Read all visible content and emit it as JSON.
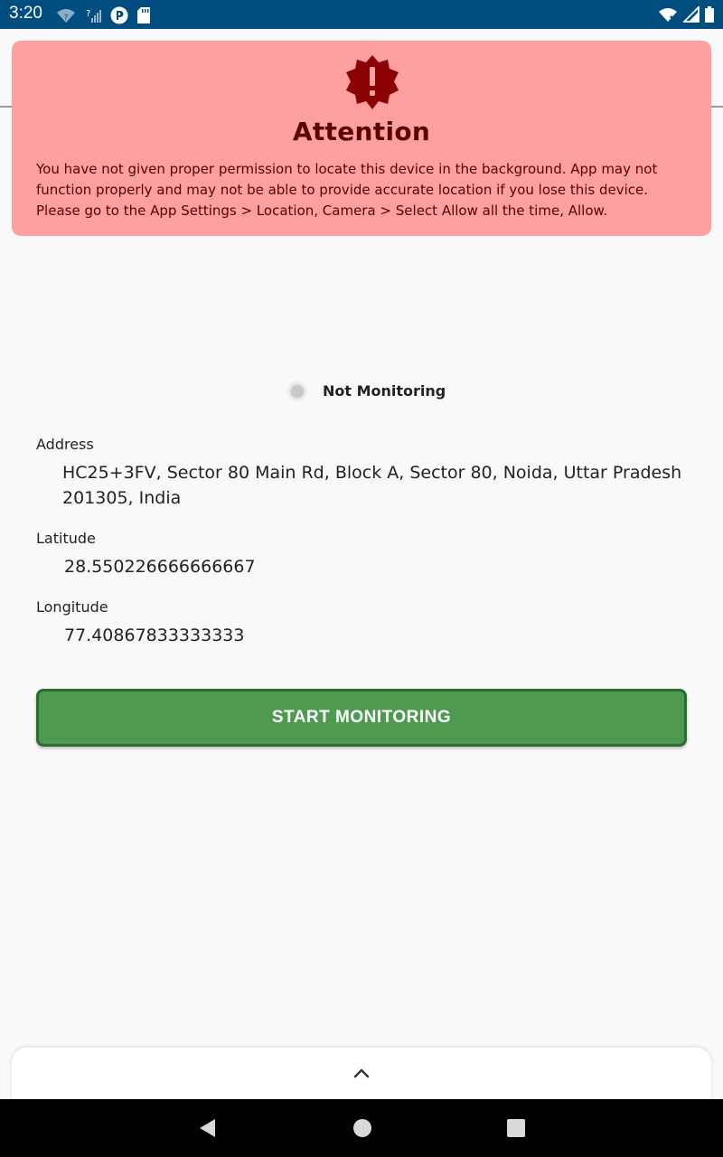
{
  "status_bar": {
    "time": "3:20",
    "background_color": "#004d7f",
    "left_icons": [
      "wifi-question-icon",
      "signal-question-icon",
      "parking-app-icon",
      "sd-card-icon"
    ],
    "right_icons": [
      "wifi-off-icon",
      "signal-icon",
      "battery-icon"
    ]
  },
  "attention": {
    "icon": "warning-badge-icon",
    "title": "Attention",
    "message": "You have not given proper permission to locate this device in the background. App may not function properly and may not be able to provide accurate location if you lose this device. Please go to the App Settings > Location, Camera > Select Allow all the time, Allow.",
    "background_color": "#ff9f9f",
    "text_color": "#5a0000"
  },
  "monitoring": {
    "status_label": "Not Monitoring",
    "indicator_color": "#c9c9c9"
  },
  "fields": {
    "address_label": "Address",
    "address_value": "HC25+3FV, Sector 80 Main Rd, Block A, Sector 80, Noida, Uttar Pradesh 201305, India",
    "latitude_label": "Latitude",
    "latitude_value": "28.550226666666667",
    "longitude_label": "Longitude",
    "longitude_value": "77.40867833333333"
  },
  "actions": {
    "start_label": "START MONITORING",
    "start_color": "#4e9a51"
  },
  "bottom_sheet": {
    "handle_icon": "chevron-up-icon"
  },
  "nav_bar": {
    "icons": [
      "back-icon",
      "home-icon",
      "recents-icon"
    ]
  }
}
